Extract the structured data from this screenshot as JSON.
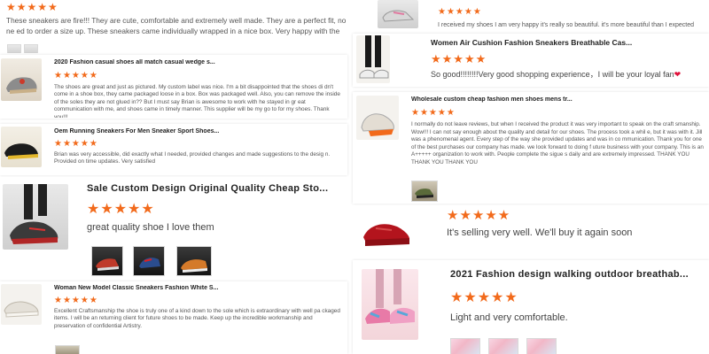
{
  "theme": {
    "star_color": "#f26a1b",
    "heart_color": "#e0103a"
  },
  "left": {
    "top_review": {
      "stars": "★★★★★",
      "text": "These sneakers are fire!!! They are cute, comfortable and extremely well made. They are a perfect fit, no ne ed to order a size up. These sneakers came individually wrapped in a nice box. Very happy with the shoes."
    },
    "reviews": [
      {
        "title": "2020 Fashion casual shoes all match casual wedge s...",
        "stars": "★★★★★",
        "text": "The shoes are great and just as pictured. My custom label was nice. I'm a bit disappointed that the shoes di dn't come in a shoe box, they came packaged loose in a box. Box was packaged well. Also, you can remove the inside of the soles they are not glued in?? But I must say Brian is awesome to work with he stayed in gr eat communication with me, and shoes came in timely manner. This supplier will be my go to for my shoes. Thank you!!!"
      },
      {
        "title": "Oem Running Sneakers For Men Sneaker Sport Shoes...",
        "stars": "★★★★★",
        "text": "Brian was very accessible, did exactly what I needed, provided changes and made suggestions to the desig n. Provided on time updates.  Very satisfied"
      },
      {
        "title": "Sale Custom Design Original Quality Cheap Sto...",
        "stars": "★★★★★",
        "text": "great quality shoe I love them"
      },
      {
        "title": "Woman New Model Classic Sneakers Fashion White S...",
        "stars": "★★★★★",
        "text": "Excellent Craftsmanship the shoe is truly one of a kind down to the sole which is extraordinary with well pa ckaged items. I will be an returning client for future shoes to be made. Keep up the incredible workmanship and preservation of confidential Artistry."
      }
    ]
  },
  "right": {
    "top_review": {
      "stars": "★★★★★",
      "text": "I received my shoes I am very happy it's really so beautiful. it's more beautiful than I expected"
    },
    "reviews": [
      {
        "title": "Women Air Cushion Fashion Sneakers Breathable Cas...",
        "stars": "★★★★★",
        "text": "So good!!!!!!!!Very good shopping experience，I will be your loyal fan",
        "heart": "❤"
      },
      {
        "title": "Wholesale custom cheap fashion men shoes mens tr...",
        "stars": "★★★★★",
        "text": "I normally do not leave reviews, but when I received the product it was very important to speak on the craft smanship.  Wow!!! I can not say enough about the quality and detail for our shoes. The process took a whil e, but it was with it. Jill was a phenomenal agent. Every step of the way she provided updates and was in co mmunication. Thank you for one of the best purchases our company has made. we look forward to doing f uture business with your company. This is an A+++++ organization to work with. People complete the sigue s daily and are extremely impressed. THANK YOU THANK YOU THANK YOU"
      },
      {
        "title": "",
        "stars": "★★★★★",
        "text": "It's selling very well. We'll buy it again soon"
      },
      {
        "title": "2021 Fashion design walking outdoor breathab...",
        "stars": "★★★★★",
        "text": "Light and very comfortable."
      }
    ]
  }
}
